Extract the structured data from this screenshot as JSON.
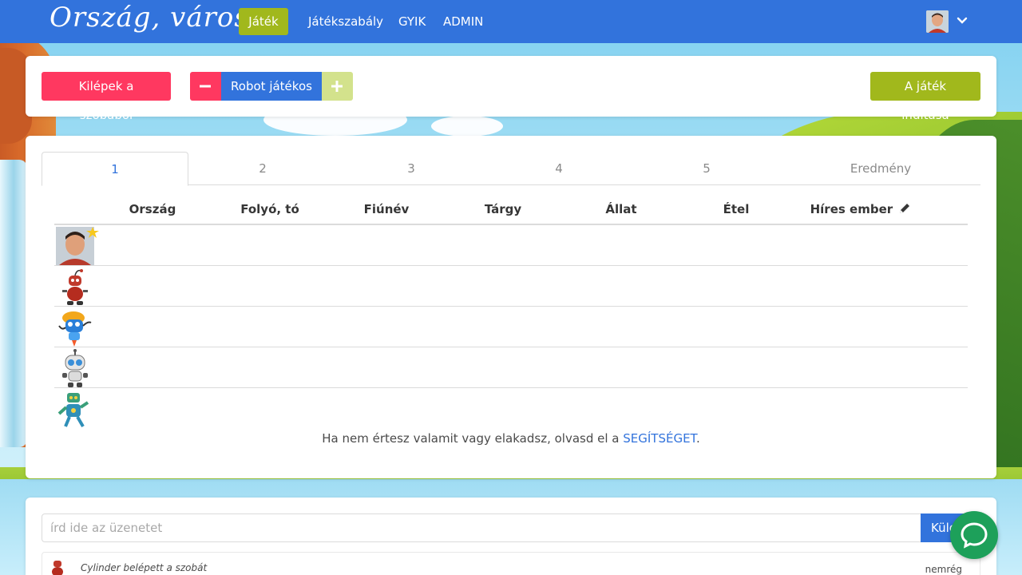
{
  "nav": {
    "brand": "Ország, város...",
    "items": [
      {
        "label": "Játék",
        "active": true
      },
      {
        "label": "Játékszabály"
      },
      {
        "label": "GYIK"
      },
      {
        "label": "ADMIN"
      }
    ],
    "avatar_icon": "user-avatar",
    "menu_icon": "chevron-down-icon"
  },
  "toolbar": {
    "leave_label": "Kilépek a szobából",
    "robot_label": "Robot játékos",
    "start_label": "A játék indítása"
  },
  "tabs": [
    "1",
    "2",
    "3",
    "4",
    "5",
    "Eredmény"
  ],
  "table": {
    "columns": [
      "Ország",
      "Folyó, tó",
      "Fiúnév",
      "Tárgy",
      "Állat",
      "Étel",
      "Híres ember"
    ],
    "rows": [
      {
        "player": "human-avatar",
        "host": true
      },
      {
        "player": "red-robot-avatar"
      },
      {
        "player": "blue-rocket-robot-avatar"
      },
      {
        "player": "white-robot-avatar"
      },
      {
        "player": "green-robot-avatar"
      }
    ]
  },
  "help": {
    "text": "Ha nem értesz valamit vagy elakadsz, olvasd el a ",
    "link": "SEGÍTSÉGET",
    "suffix": "."
  },
  "chat": {
    "placeholder": "írd ide az üzenetet",
    "send_label": "Küld",
    "messages": [
      {
        "text": "Cylinder belépett a szobát",
        "time": "nemrég"
      }
    ]
  },
  "colors": {
    "primary": "#3273dc",
    "danger": "#ff3860",
    "success": "#a1b81c",
    "chat_bubble": "#1da05a"
  }
}
